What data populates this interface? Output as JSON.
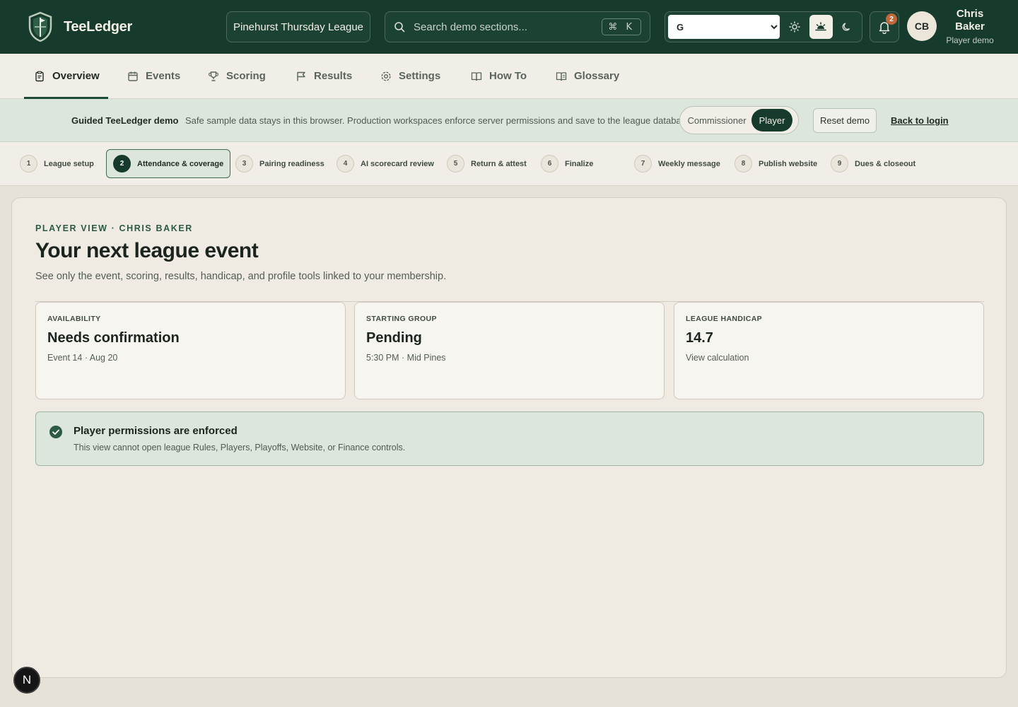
{
  "app": {
    "name": "TeeLedger"
  },
  "header": {
    "league_button": "Pinehurst Thursday League",
    "search_placeholder": "Search demo sections...",
    "shortcut": "⌘ K",
    "theme_selected": "G",
    "notification_count": "2",
    "user": {
      "initials": "CB",
      "name": "Chris Baker",
      "role": "Player demo"
    }
  },
  "nav": {
    "items": [
      {
        "label": "Overview",
        "icon": "clipboard-icon"
      },
      {
        "label": "Events",
        "icon": "calendar-icon"
      },
      {
        "label": "Scoring",
        "icon": "trophy-icon"
      },
      {
        "label": "Results",
        "icon": "flag-icon"
      },
      {
        "label": "Settings",
        "icon": "gear-icon"
      },
      {
        "label": "How To",
        "icon": "book-icon"
      },
      {
        "label": "Glossary",
        "icon": "book-icon"
      }
    ],
    "active": "Overview"
  },
  "banner": {
    "title": "Guided TeeLedger demo",
    "text": "Safe sample data stays in this browser. Production workspaces enforce server permissions and save to the league database.",
    "roles": [
      "Commissioner",
      "Player"
    ],
    "active_role": "Player",
    "reset_label": "Reset demo",
    "login_label": "Back to login"
  },
  "steps": [
    {
      "num": "1",
      "label": "League setup"
    },
    {
      "num": "2",
      "label": "Attendance & coverage"
    },
    {
      "num": "3",
      "label": "Pairing readiness"
    },
    {
      "num": "4",
      "label": "AI scorecard review"
    },
    {
      "num": "5",
      "label": "Return & attest"
    },
    {
      "num": "6",
      "label": "Finalize"
    },
    {
      "num": "7",
      "label": "Weekly message"
    },
    {
      "num": "8",
      "label": "Publish website"
    },
    {
      "num": "9",
      "label": "Dues & closeout"
    }
  ],
  "active_step": "2",
  "main": {
    "eyebrow": "PLAYER VIEW · CHRIS BAKER",
    "title": "Your next league event",
    "subtitle": "See only the event, scoring, results, handicap, and profile tools linked to your membership.",
    "stats": [
      {
        "label": "AVAILABILITY",
        "value": "Needs confirmation",
        "note": "Event 14 · Aug 20"
      },
      {
        "label": "STARTING GROUP",
        "value": "Pending",
        "note": "5:30 PM · Mid Pines"
      },
      {
        "label": "LEAGUE HANDICAP",
        "value": "14.7",
        "note": "View calculation"
      }
    ],
    "permission": {
      "title": "Player permissions are enforced",
      "text": "This view cannot open league Rules, Players, Playoffs, Website, or Finance controls."
    }
  },
  "floating_badge": "N",
  "colors": {
    "header_bg": "#163a2c",
    "accent": "#2c5a44",
    "banner_bg": "#dce6dc",
    "badge": "#c2673a"
  }
}
